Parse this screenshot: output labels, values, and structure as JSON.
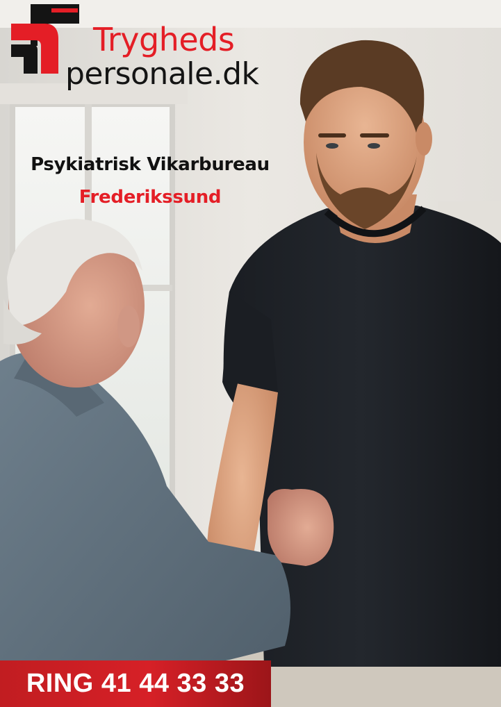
{
  "brand": {
    "logo_line1": "Trygheds",
    "logo_line2": "personale.dk",
    "accent_color": "#e41e26",
    "dark_color": "#141414"
  },
  "headline": {
    "title": "Psykiatrisk Vikarbureau",
    "location": "Frederikssund"
  },
  "cta": {
    "label": "RING 41 44 33 33",
    "background_color": "#d62027"
  },
  "photo": {
    "icon": "photo-scene"
  }
}
